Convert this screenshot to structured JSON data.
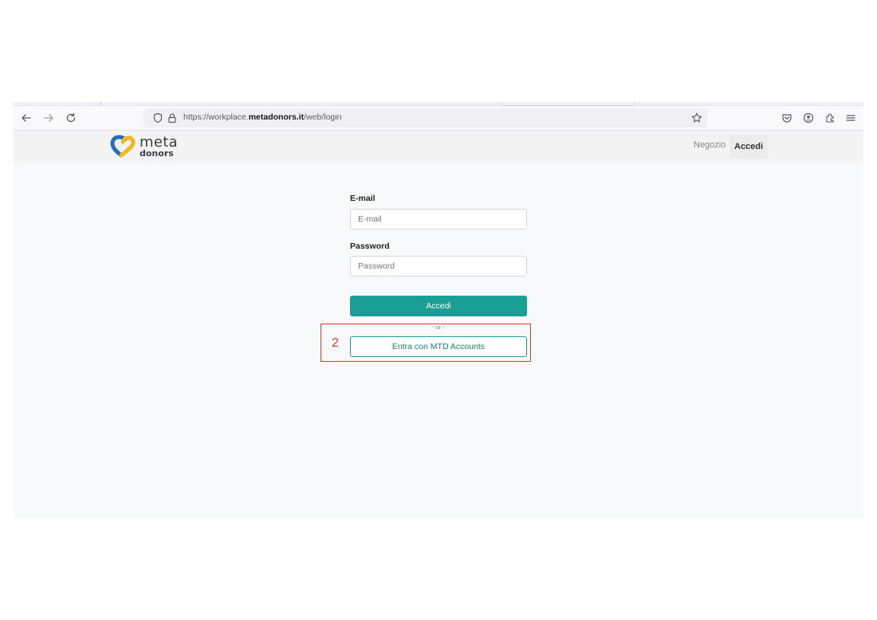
{
  "browser": {
    "url": {
      "prefix": "https://workplace.",
      "domain": "metadonors.it",
      "path": "/web/login"
    }
  },
  "site": {
    "logo": {
      "line1": "meta",
      "line2": "donors"
    },
    "nav": {
      "shop": "Negozio",
      "login": "Accedi"
    }
  },
  "form": {
    "email_label": "E-mail",
    "email_placeholder": "E-mail",
    "password_label": "Password",
    "password_placeholder": "Password",
    "submit_label": "Accedi",
    "separator": "- or -",
    "oauth_label": "Entra con MTD Accounts"
  },
  "annotation": {
    "number": "2"
  },
  "colors": {
    "accent": "#1b9e94",
    "annotation": "#e23a2a",
    "logo_blue": "#2a6fb5",
    "logo_yellow": "#f3b71b"
  }
}
